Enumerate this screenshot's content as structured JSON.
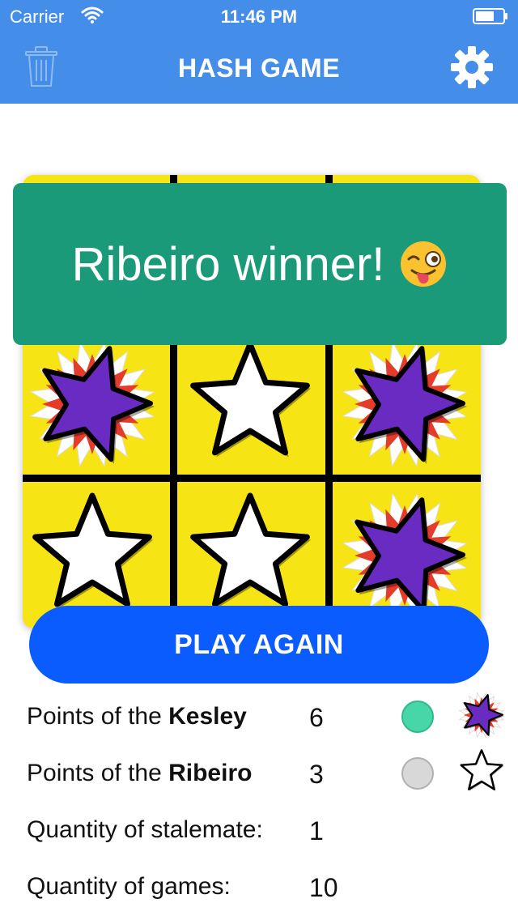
{
  "status_bar": {
    "carrier": "Carrier",
    "time": "11:46 PM"
  },
  "nav": {
    "title": "HASH GAME",
    "left_icon": "trash-icon",
    "right_icon": "gear-icon"
  },
  "banner": {
    "message": "Ribeiro winner!",
    "emoji_icon": "winking-tongue-face"
  },
  "board": {
    "visible_cells": [
      [
        "purple",
        "white",
        "purple"
      ],
      [
        "white",
        "white",
        "purple"
      ]
    ]
  },
  "play_again": {
    "label": "PLAY AGAIN"
  },
  "stats": {
    "player1": {
      "prefix": "Points of the ",
      "name": "Kesley",
      "value": "6",
      "dot_color": "#47d6a8",
      "star_icon": "purple-star-icon"
    },
    "player2": {
      "prefix": "Points of the ",
      "name": "Ribeiro",
      "value": "3",
      "dot_color": "#d8d8d8",
      "star_icon": "white-star-icon"
    },
    "stalemate": {
      "label": "Quantity of stalemate:",
      "value": "1"
    },
    "games": {
      "label": "Quantity of games:",
      "value": "10"
    }
  },
  "colors": {
    "nav_blue": "#448de9",
    "banner_green": "#1a9a78",
    "button_blue": "#0a5cff",
    "board_yellow": "#f7e414",
    "star_purple": "#6a2bc2"
  }
}
